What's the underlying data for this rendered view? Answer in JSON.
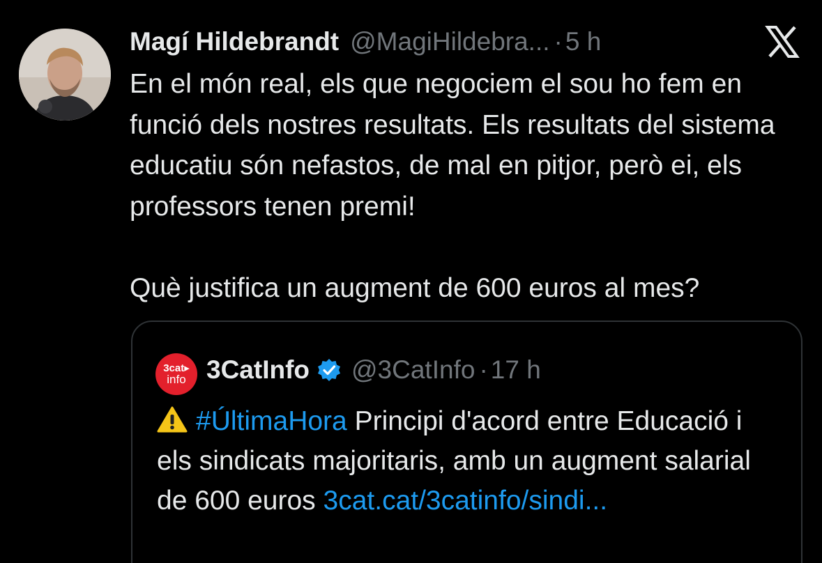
{
  "tweet": {
    "author_name": "Magí Hildebrandt",
    "author_handle": "@MagiHildebra...",
    "separator": "·",
    "time": "5 h",
    "text_paragraph_1": "En el món real, els que negociem el sou ho fem en funció dels nostres resultats. Els resultats del sistema educatiu són nefastos, de mal en pitjor, però ei, els professors tenen premi!",
    "text_paragraph_2": "Què justifica un augment de 600 euros al mes?"
  },
  "quote": {
    "author_name": "3CatInfo",
    "author_handle": "@3CatInfo",
    "separator": "·",
    "time": "17 h",
    "avatar_line_1": "3cat▸",
    "avatar_line_2": "info",
    "hashtag": "#ÚltimaHora",
    "text": " Principi d'acord entre Educació i els sindicats majoritaris, amb un augment salarial de 600 euros ",
    "link": "3cat.cat/3catinfo/sindi..."
  },
  "icons": {
    "platform": "x-logo-icon",
    "verified": "verified-badge-icon",
    "warning": "warning-icon"
  },
  "colors": {
    "background": "#000000",
    "text": "#e7e9ea",
    "secondary": "#71767b",
    "link": "#1d9bf0",
    "border": "#2f3336",
    "quote_avatar": "#e3202c"
  }
}
